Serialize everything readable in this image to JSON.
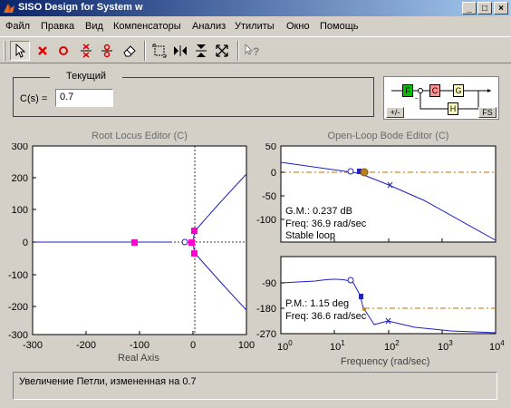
{
  "window": {
    "title": "SISO Design for System w"
  },
  "menu": [
    "Файл",
    "Правка",
    "Вид",
    "Компенсаторы",
    "Анализ",
    "Утилиты",
    "Окно",
    "Помощь"
  ],
  "toolbar": {
    "tools": [
      "pointer-tool-icon",
      "add-real-pole-icon",
      "add-real-zero-icon",
      "add-complex-pole-icon",
      "add-complex-zero-icon",
      "erase-icon",
      "zoom-xy-icon",
      "zoom-x-icon",
      "zoom-y-icon",
      "fit-view-icon",
      "context-help-icon"
    ]
  },
  "compensator": {
    "legend": "Текущий",
    "label": "C(s) =",
    "value": "0.7"
  },
  "block_diagram": {
    "blocks": [
      "F",
      "C",
      "G",
      "H"
    ],
    "sign_button": "+/-",
    "fs_button": "FS",
    "minus_sign": "-"
  },
  "root_locus": {
    "title": "Root Locus Editor (C)",
    "x_ticks": [
      "-300",
      "-200",
      "-100",
      "0",
      "100"
    ],
    "y_ticks": [
      "300",
      "200",
      "100",
      "0",
      "-100",
      "-200",
      "-300"
    ],
    "xlabel": "Real Axis"
  },
  "bode": {
    "title": "Open-Loop Bode Editor (C)",
    "mag_ticks": [
      "50",
      "0",
      "-50",
      "-100"
    ],
    "phase_ticks": [
      "-90",
      "-180",
      "-270"
    ],
    "freq_ticks": {
      "base": "10",
      "exps": [
        "0",
        "1",
        "2",
        "3",
        "4"
      ]
    },
    "xlabel": "Frequency (rad/sec)",
    "gm_text": "G.M.: 0.237 dB",
    "gm_freq": "Freq: 36.9 rad/sec",
    "stability": "Stable loop",
    "pm_text": "P.M.: 1.15 deg",
    "pm_freq": "Freq: 36.6 rad/sec"
  },
  "status": "Увеличение Петли, измененная на 0.7",
  "colors": {
    "title_start": "#0a246a",
    "title_end": "#a6caf0",
    "locus": "#2020c0",
    "closed_loop_poles": "#ff00cc",
    "margin_marker": "#c08020",
    "margin_line": "#c07000"
  }
}
